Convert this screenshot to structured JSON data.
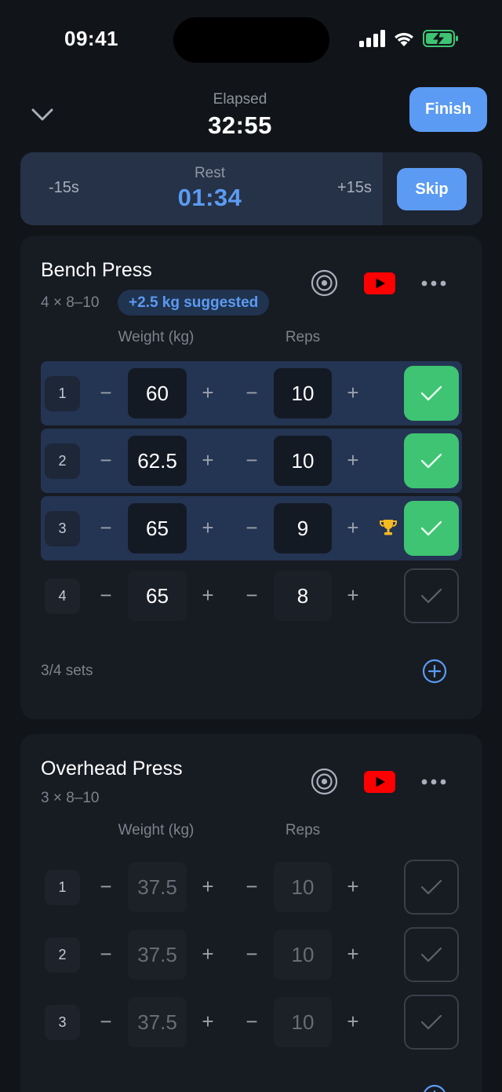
{
  "status_bar": {
    "time": "09:41"
  },
  "header": {
    "elapsed_label": "Elapsed",
    "elapsed_time": "32:55",
    "finish_label": "Finish"
  },
  "rest": {
    "minus_label": "-15s",
    "label": "Rest",
    "time": "01:34",
    "plus_label": "+15s",
    "skip_label": "Skip"
  },
  "colors": {
    "accent": "#5b9bf3",
    "complete": "#3ec472",
    "youtube": "#ff0000",
    "trophy": "#f5b921",
    "background": "#111419"
  },
  "icons": {
    "collapse": "chevron-down-icon",
    "target": "target-icon",
    "video": "youtube-icon",
    "more": "more-icon",
    "add": "plus-circle-icon",
    "check": "check-icon",
    "record": "trophy-icon"
  },
  "exercises": [
    {
      "name": "Bench Press",
      "meta": "4 × 8–10",
      "suggestion": "+2.5 kg suggested",
      "weight_header": "Weight (kg)",
      "reps_header": "Reps",
      "minus_symbol": "−",
      "plus_symbol": "+",
      "sets": [
        {
          "num": "1",
          "weight": "60",
          "reps": "10",
          "completed": true,
          "record": false
        },
        {
          "num": "2",
          "weight": "62.5",
          "reps": "10",
          "completed": true,
          "record": false
        },
        {
          "num": "3",
          "weight": "65",
          "reps": "9",
          "completed": true,
          "record": true
        },
        {
          "num": "4",
          "weight": "65",
          "reps": "8",
          "completed": false,
          "record": false
        }
      ],
      "sets_count": "3/4 sets"
    },
    {
      "name": "Overhead Press",
      "meta": "3 × 8–10",
      "weight_header": "Weight (kg)",
      "reps_header": "Reps",
      "minus_symbol": "−",
      "plus_symbol": "+",
      "sets": [
        {
          "num": "1",
          "weight": "37.5",
          "reps": "10",
          "completed": false,
          "record": false
        },
        {
          "num": "2",
          "weight": "37.5",
          "reps": "10",
          "completed": false,
          "record": false
        },
        {
          "num": "3",
          "weight": "37.5",
          "reps": "10",
          "completed": false,
          "record": false
        }
      ]
    }
  ]
}
